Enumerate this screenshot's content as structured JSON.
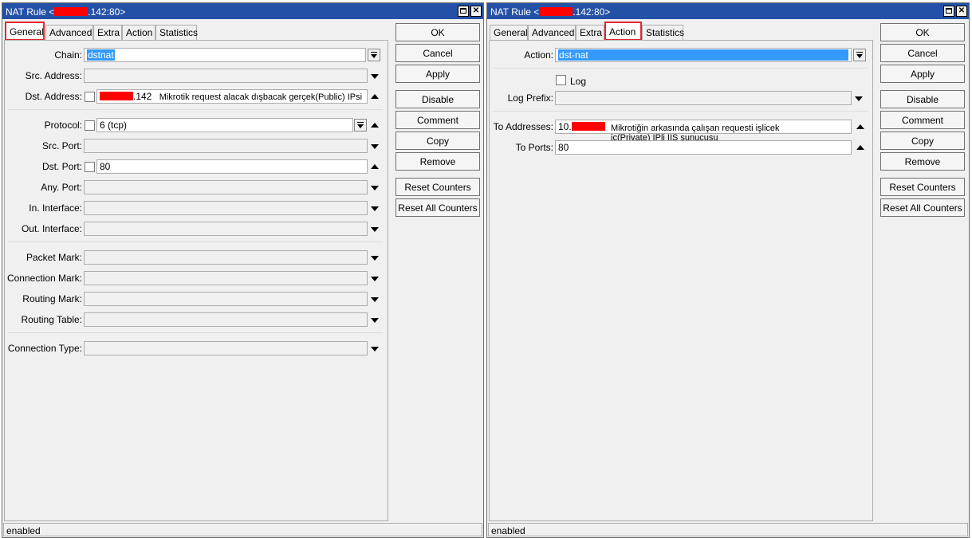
{
  "left_window": {
    "title_prefix": "NAT Rule <",
    "title_suffix": ".142:80>",
    "tabs": [
      "General",
      "Advanced",
      "Extra",
      "Action",
      "Statistics"
    ],
    "active_tab": "General",
    "fields": {
      "chain_label": "Chain:",
      "chain_value": "dstnat",
      "src_address_label": "Src. Address:",
      "dst_address_label": "Dst. Address:",
      "dst_address_value": ".142",
      "dst_address_note": "Mikrotik request alacak dışbacak gerçek(Public) IPsi",
      "protocol_label": "Protocol:",
      "protocol_value": "6 (tcp)",
      "src_port_label": "Src. Port:",
      "dst_port_label": "Dst. Port:",
      "dst_port_value": "80",
      "any_port_label": "Any. Port:",
      "in_interface_label": "In. Interface:",
      "out_interface_label": "Out. Interface:",
      "packet_mark_label": "Packet Mark:",
      "connection_mark_label": "Connection Mark:",
      "routing_mark_label": "Routing Mark:",
      "routing_table_label": "Routing Table:",
      "connection_type_label": "Connection Type:"
    },
    "status": "enabled"
  },
  "right_window": {
    "title_prefix": "NAT Rule <",
    "title_suffix": ".142:80>",
    "tabs": [
      "General",
      "Advanced",
      "Extra",
      "Action",
      "Statistics"
    ],
    "active_tab": "Action",
    "fields": {
      "action_label": "Action:",
      "action_value": "dst-nat",
      "log_label": "Log",
      "log_prefix_label": "Log Prefix:",
      "to_addresses_label": "To Addresses:",
      "to_addresses_value": "10.",
      "to_addresses_note_line1": "Mikrotiğin arkasında çalışan requesti işlicek",
      "to_addresses_note_line2": "iç(Private) IPli IIS sunucusu",
      "to_ports_label": "To Ports:",
      "to_ports_value": "80"
    },
    "status": "enabled"
  },
  "buttons": {
    "ok": "OK",
    "cancel": "Cancel",
    "apply": "Apply",
    "disable": "Disable",
    "comment": "Comment",
    "copy": "Copy",
    "remove": "Remove",
    "reset_counters": "Reset Counters",
    "reset_all_counters": "Reset All Counters"
  },
  "colors": {
    "titlebar": "#2451a8",
    "highlight": "#e3262d",
    "redaction": "#ff0000",
    "selection": "#3399ff"
  }
}
